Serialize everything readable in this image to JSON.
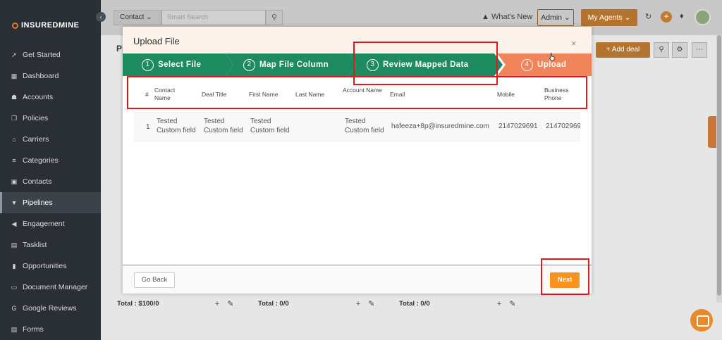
{
  "sidebar": {
    "brand": "INSUREDMINE",
    "collapse": "‹",
    "items": [
      {
        "label": "Get Started",
        "icon": "rocket-icon",
        "glyph": "➚"
      },
      {
        "label": "Dashboard",
        "icon": "dashboard-icon",
        "glyph": "▦"
      },
      {
        "label": "Accounts",
        "icon": "accounts-icon",
        "glyph": "☗"
      },
      {
        "label": "Policies",
        "icon": "policies-icon",
        "glyph": "❐"
      },
      {
        "label": "Carriers",
        "icon": "carriers-icon",
        "glyph": "⌂"
      },
      {
        "label": "Categories",
        "icon": "categories-icon",
        "glyph": "≡"
      },
      {
        "label": "Contacts",
        "icon": "contacts-icon",
        "glyph": "▣"
      },
      {
        "label": "Pipelines",
        "icon": "pipelines-icon",
        "glyph": "▼"
      },
      {
        "label": "Engagement",
        "icon": "megaphone-icon",
        "glyph": "◀"
      },
      {
        "label": "Tasklist",
        "icon": "tasklist-icon",
        "glyph": "▤"
      },
      {
        "label": "Opportunities",
        "icon": "opportunities-icon",
        "glyph": "▮"
      },
      {
        "label": "Document Manager",
        "icon": "folder-icon",
        "glyph": "▭"
      },
      {
        "label": "Google Reviews",
        "icon": "google-icon",
        "glyph": "G"
      },
      {
        "label": "Forms",
        "icon": "forms-icon",
        "glyph": "▤"
      }
    ],
    "active_index": 7
  },
  "topbar": {
    "context_select": "Contact ⌄",
    "search_placeholder": "Smart Search",
    "whats_new": "What's New",
    "admin": "Admin ⌄",
    "my_agents": "My Agents ⌄",
    "plus": "+"
  },
  "background": {
    "page_title": "Pi",
    "add_deal": "+  Add deal",
    "totals": [
      "Total : $100/0",
      "Total : 0/0",
      "Total : 0/0"
    ]
  },
  "modal": {
    "title": "Upload File",
    "close": "×",
    "steps": [
      {
        "num": "1",
        "label": "Select File"
      },
      {
        "num": "2",
        "label": "Map File Column"
      },
      {
        "num": "3",
        "label": "Review Mapped Data"
      },
      {
        "num": "4",
        "label": "Upload"
      }
    ],
    "columns": [
      "#",
      "Contact Name",
      "Deal Title",
      "First Name",
      "Last Name",
      "Account Name",
      "Email",
      "Mobile",
      "Business Phone"
    ],
    "rows": [
      {
        "num": "1",
        "contact_name": "Tested Custom field",
        "deal_title": "Tested Custom field",
        "first_name": "Tested Custom field",
        "last_name": "",
        "account_name": "Tested Custom field",
        "email": "hafeeza+8p@insuredmine.com",
        "mobile": "2147029691",
        "business_phone": "214702969"
      }
    ],
    "go_back": "Go Back",
    "next": "Next"
  },
  "colors": {
    "step_done": "#1d8a60",
    "step_pending": "#f0845a",
    "accent": "#f7931e",
    "highlight": "#e01a1a"
  }
}
